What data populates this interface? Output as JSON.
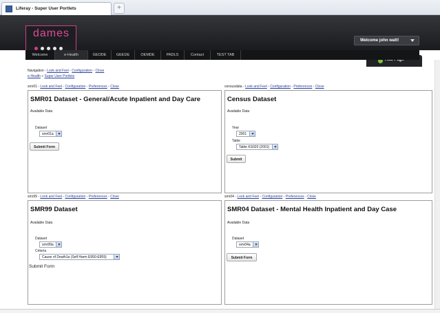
{
  "browser": {
    "tab_title": "Liferay - Super User Portlets",
    "new_tab": "+"
  },
  "header": {
    "logo_text": "dames",
    "welcome": "Welcome john watt!",
    "add_page": "Add Page",
    "logo_dot_colors": [
      "#d13f8c",
      "#e8e8e8",
      "#e8e8e8",
      "#e8e8e8",
      "#e8e8e8"
    ]
  },
  "nav": {
    "items": [
      "Welcome",
      "e-Health",
      "GEODE",
      "GEEDE",
      "OEMDE",
      "PADLS",
      "Contact",
      "TEST TAB"
    ]
  },
  "page": {
    "navigation_label": "Navigation",
    "breadcrumb_root": "e-Health",
    "breadcrumb_current": "Super User Portlets",
    "links": {
      "look": "Look and Feel",
      "config": "Configuration",
      "prefs": "Preferences",
      "close": "Close"
    }
  },
  "portlets": {
    "smr01": {
      "id": "smr01",
      "title": "SMR01 Dataset - General/Acute Inpatient and Day Care",
      "available": "Available Data",
      "dataset_label": "Dataset",
      "dataset_value": "smr01a",
      "submit": "Submit Form"
    },
    "census": {
      "id": "censusdata",
      "title": "Census Dataset",
      "available": "Available Data",
      "year_label": "Year",
      "year_value": "2001",
      "table_label": "Table",
      "table_value": "Table KS020 (2001)",
      "submit": "Submit"
    },
    "smr99": {
      "id": "smr99",
      "title": "SMR99 Dataset",
      "available": "Available Data",
      "dataset_label": "Dataset",
      "dataset_value": "smr99a",
      "criteria_label": "Criteria",
      "criteria_value": "Cause of Death1a (Self Harm E950-E959)",
      "submit": "Submit Form"
    },
    "smr04": {
      "id": "smr04",
      "title": "SMR04 Dataset - Mental Health Inpatient and Day Case",
      "available": "Available Data",
      "dataset_label": "Dataset",
      "dataset_value": "smr04a",
      "submit": "Submit Form"
    }
  }
}
